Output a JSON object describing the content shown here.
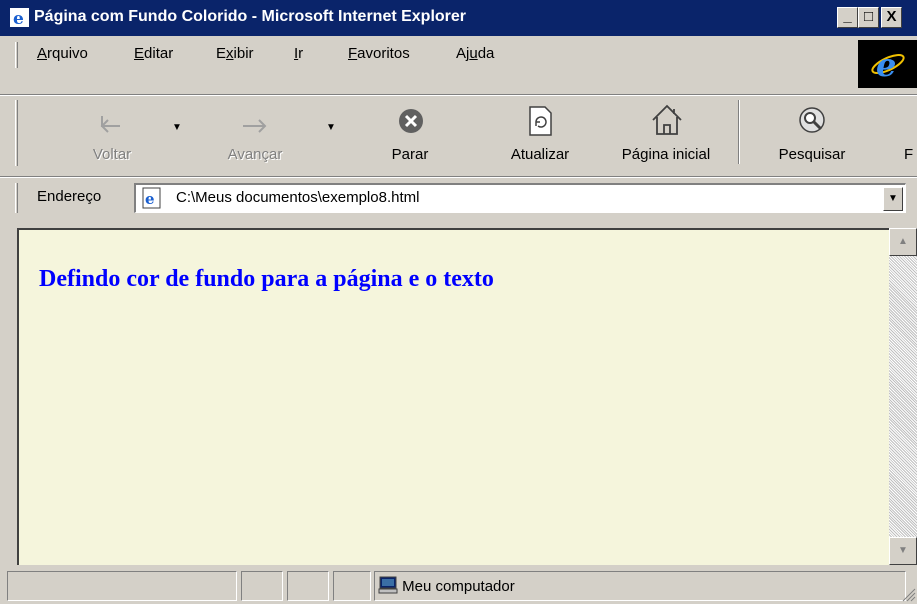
{
  "window": {
    "title": "Página com Fundo Colorido - Microsoft Internet Explorer"
  },
  "window_buttons": {
    "minimize": "_",
    "maximize": "□",
    "close": "X"
  },
  "menu": {
    "items": [
      {
        "accel": "A",
        "rest": "rquivo"
      },
      {
        "accel": "E",
        "rest": "ditar"
      },
      {
        "pre": "E",
        "accel": "x",
        "rest": "ibir"
      },
      {
        "accel": "I",
        "rest": "r"
      },
      {
        "accel": "F",
        "rest": "avoritos"
      },
      {
        "pre": "Aj",
        "accel": "u",
        "rest": "da"
      }
    ]
  },
  "toolbar": {
    "back": {
      "label": "Voltar",
      "icon": "back-arrow-icon",
      "enabled": false
    },
    "forward": {
      "label": "Avançar",
      "icon": "forward-arrow-icon",
      "enabled": false
    },
    "stop": {
      "label": "Parar",
      "icon": "stop-icon"
    },
    "refresh": {
      "label": "Atualizar",
      "icon": "refresh-icon"
    },
    "home": {
      "label": "Página inicial",
      "icon": "home-icon"
    },
    "search": {
      "label": "Pesquisar",
      "icon": "search-icon"
    },
    "next_partial": {
      "label": "F"
    }
  },
  "address": {
    "label": "Endereço",
    "value": "C:\\Meus documentos\\exemplo8.html"
  },
  "page": {
    "heading": "Defindo cor de fundo para a página e o texto",
    "background_color": "#f5f5dc",
    "text_color": "#0000ff"
  },
  "status": {
    "zone": "Meu computador",
    "zone_icon": "computer-icon"
  }
}
